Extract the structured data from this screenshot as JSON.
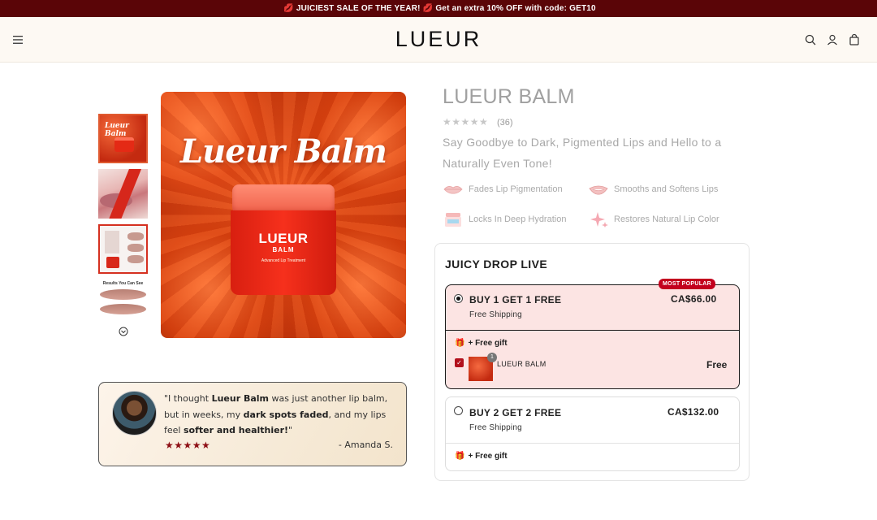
{
  "announcement": {
    "text1": "JUICIEST SALE OF THE YEAR!",
    "text2": "Get an extra 10% OFF with code: GET10"
  },
  "header": {
    "logo": "LUEUR",
    "icons": [
      "menu-icon",
      "search-icon",
      "account-icon",
      "cart-icon"
    ]
  },
  "gallery": {
    "main_title": "Lueur Balm",
    "jar_brand": "LUEUR",
    "jar_sub": "BALM",
    "jar_desc": "Advanced Lip Treatment",
    "thumb1_text": "Lueur Balm",
    "thumb4_caption": "Results You Can See"
  },
  "review": {
    "part1": "\"I thought ",
    "bold1": "Lueur Balm",
    "part2": " was just another lip balm, but in weeks, my ",
    "bold2": "dark spots faded",
    "part3": ", and my lips feel ",
    "bold3": "softer and healthier!",
    "part4": "\"",
    "stars": "★★★★★",
    "author": "- Amanda S."
  },
  "product": {
    "title": "LUEUR BALM",
    "stars": "★★★★★",
    "review_count": "(36)",
    "tagline": "Say Goodbye to Dark, Pigmented Lips and Hello to a Naturally Even Tone!",
    "features": [
      {
        "label": "Fades Lip Pigmentation",
        "icon": "lips-icon"
      },
      {
        "label": "Smooths and Softens Lips",
        "icon": "smile-lips-icon"
      },
      {
        "label": "Locks In Deep Hydration",
        "icon": "jar-icon"
      },
      {
        "label": "Restores Natural Lip Color",
        "icon": "sparkle-icon"
      }
    ]
  },
  "offer": {
    "title": "JUICY DROP LIVE",
    "badge": "MOST POPULAR",
    "options": [
      {
        "title": "BUY 1 GET 1 FREE",
        "shipping": "Free Shipping",
        "price": "CA$66.00",
        "gift_label": "+ Free gift",
        "gift_name": "LUEUR BALM",
        "gift_qty": "1",
        "gift_price": "Free",
        "selected": true
      },
      {
        "title": "BUY 2 GET 2 FREE",
        "shipping": "Free Shipping",
        "price": "CA$132.00",
        "gift_label": "+ Free gift",
        "selected": false
      }
    ]
  },
  "colors": {
    "announce_bg": "#5a0507",
    "header_bg": "#fdf9f3",
    "selected_option_bg": "#fce4e3",
    "badge_bg": "#c3001d",
    "review_star": "#8e0f15"
  }
}
